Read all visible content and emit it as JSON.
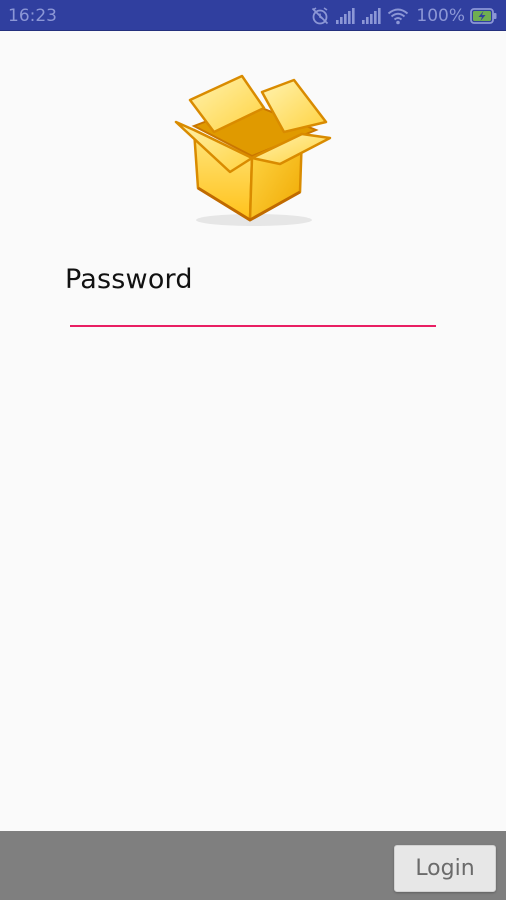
{
  "status_bar": {
    "time": "16:23",
    "battery": "100%",
    "icons": [
      "alarm-off-icon",
      "signal-icon",
      "signal-icon",
      "wifi-icon",
      "battery-charging-icon"
    ],
    "background_color": "#303f9f"
  },
  "logo": {
    "icon": "open-box-icon"
  },
  "form": {
    "password_label": "Password",
    "password_value": "",
    "accent_color": "#e91e63"
  },
  "bottom_bar": {
    "login_label": "Login",
    "background_color": "#7f7f7f"
  }
}
